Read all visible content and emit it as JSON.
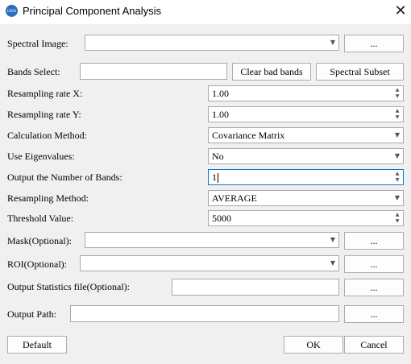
{
  "window": {
    "title": "Principal Component Analysis",
    "icon_name": "app-logo-icon",
    "close_icon": "close-icon"
  },
  "spectral_image": {
    "label": "Spectral Image:",
    "value": "",
    "browse_label": "..."
  },
  "bands_select": {
    "label": "Bands Select:",
    "value": "",
    "clear_bad_bands_label": "Clear bad bands",
    "spectral_subset_label": "Spectral Subset"
  },
  "resampling_rate_x": {
    "label": "Resampling rate X:",
    "value": "1.00"
  },
  "resampling_rate_y": {
    "label": "Resampling rate Y:",
    "value": "1.00"
  },
  "calculation_method": {
    "label": "Calculation Method:",
    "value": "Covariance Matrix"
  },
  "use_eigenvalues": {
    "label": "Use Eigenvalues:",
    "value": "No"
  },
  "output_bands": {
    "label": "Output the Number of Bands:",
    "value": "1"
  },
  "resampling_method": {
    "label": "Resampling Method:",
    "value": "AVERAGE"
  },
  "threshold_value": {
    "label": "Threshold Value:",
    "value": "5000"
  },
  "mask": {
    "label": "Mask(Optional):",
    "value": "",
    "browse_label": "..."
  },
  "roi": {
    "label": "ROI(Optional):",
    "value": "",
    "browse_label": "..."
  },
  "statistics_file": {
    "label": "Output Statistics file(Optional):",
    "value": "",
    "browse_label": "..."
  },
  "output_path": {
    "label": "Output Path:",
    "value": "",
    "browse_label": "..."
  },
  "footer": {
    "default_label": "Default",
    "ok_label": "OK",
    "cancel_label": "Cancel"
  }
}
